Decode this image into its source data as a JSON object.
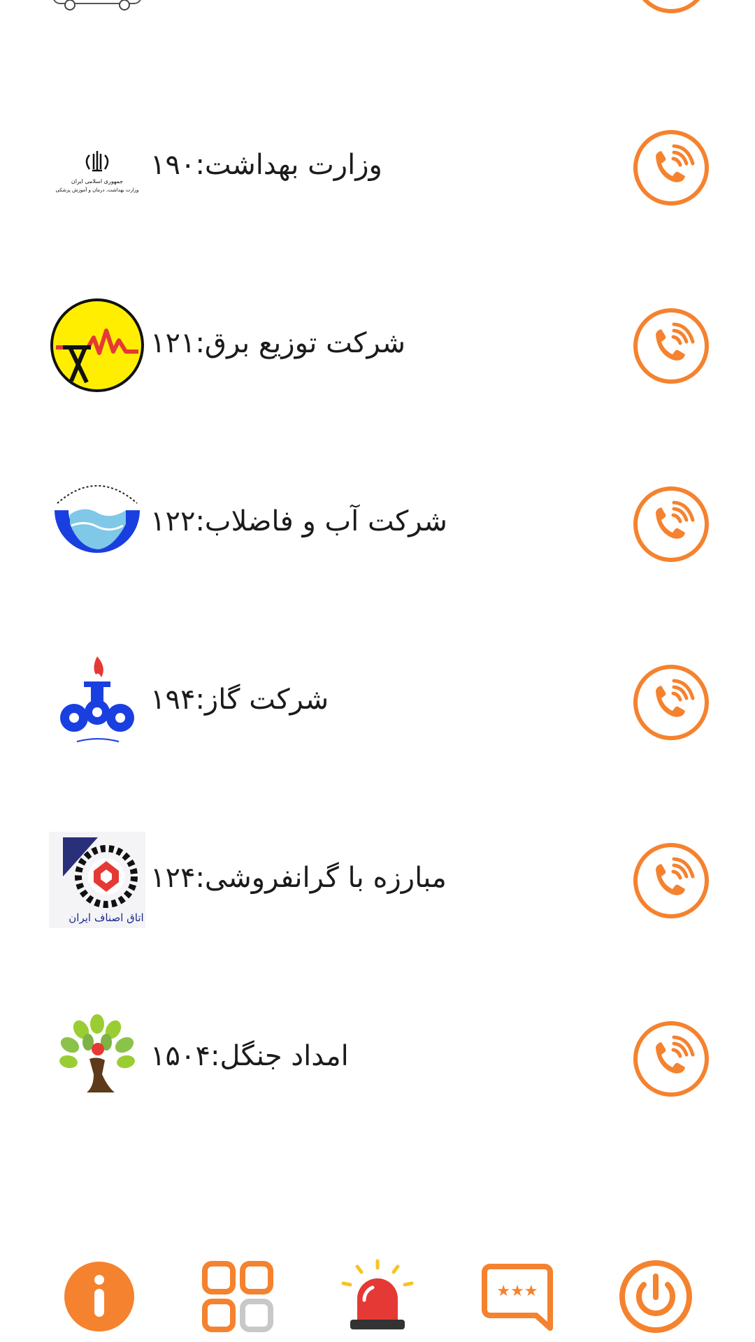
{
  "entries": [
    {
      "label": "وزارت بهداشت:۱۹۰",
      "logo_icon": "iran-health-ministry-emblem-icon",
      "action_icon": "phone-call-icon"
    },
    {
      "label": "شرکت توزیع برق:۱۲۱",
      "logo_icon": "electricity-distribution-logo-icon",
      "action_icon": "phone-call-icon"
    },
    {
      "label": "شرکت آب و فاضلاب:۱۲۲",
      "logo_icon": "water-and-wastewater-logo-icon",
      "action_icon": "phone-call-icon"
    },
    {
      "label": "شرکت گاز:۱۹۴",
      "logo_icon": "gas-company-logo-icon",
      "action_icon": "phone-call-icon"
    },
    {
      "label": "مبارزه با گرانفروشی:۱۲۴",
      "logo_icon": "guild-chamber-logo-icon",
      "action_icon": "phone-call-icon"
    },
    {
      "label": "امداد جنگل:۱۵۰۴",
      "logo_icon": "forest-rescue-tree-logo-icon",
      "action_icon": "phone-call-icon"
    }
  ],
  "logo_text": {
    "health": "جمهوری اسلامی ایران",
    "health_sub": "وزارت بهداشت، درمان و آموزش پزشکی",
    "guild": "اتاق اصناف ایران"
  },
  "bottom_nav": [
    {
      "icon": "info-icon"
    },
    {
      "icon": "apps-grid-icon"
    },
    {
      "icon": "emergency-siren-icon"
    },
    {
      "icon": "chat-bubble-icon"
    },
    {
      "icon": "power-icon"
    }
  ],
  "colors": {
    "accent": "#F5822E",
    "text": "#1B1B1B",
    "siren_red": "#E53935",
    "water_blue": "#1A3FE0",
    "electric_yellow": "#FFEE00"
  }
}
